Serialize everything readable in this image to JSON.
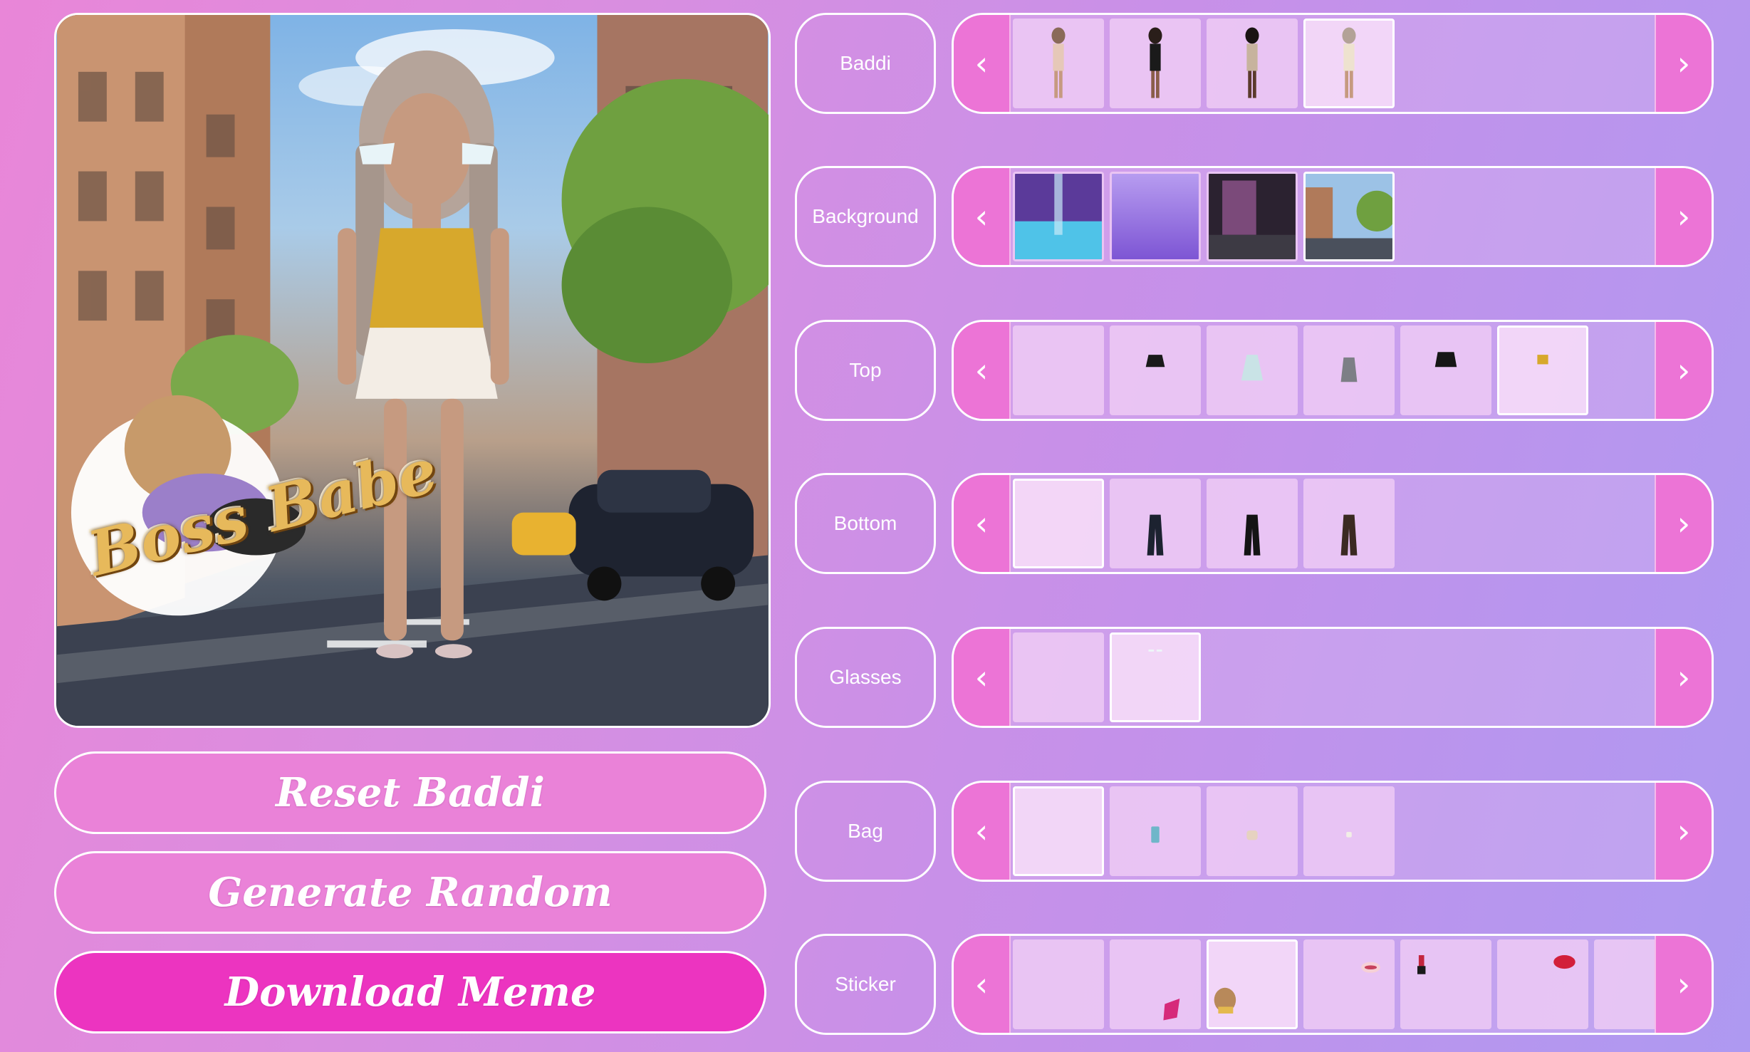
{
  "preview": {
    "sticker_text": "Boss Babe"
  },
  "actions": {
    "reset_label": "Reset Baddi",
    "random_label": "Generate Random",
    "download_label": "Download Meme"
  },
  "arrows": {
    "prev": "‹",
    "next": "›"
  },
  "categories": [
    {
      "label": "Baddi",
      "thumbs": [
        "doll-1",
        "doll-2",
        "doll-3",
        "doll-4"
      ],
      "selected": 3
    },
    {
      "label": "Background",
      "thumbs": [
        "pool-scene",
        "purple-gradient",
        "dark-room",
        "city-street"
      ],
      "selected": 3
    },
    {
      "label": "Top",
      "thumbs": [
        "none",
        "black-jacket",
        "light-dress",
        "patterned-top",
        "black-crop",
        "gold-top"
      ],
      "selected": 5
    },
    {
      "label": "Bottom",
      "thumbs": [
        "none",
        "flare-pants-dark",
        "flare-pants-black",
        "flare-pants-brown"
      ],
      "selected": 0
    },
    {
      "label": "Glasses",
      "thumbs": [
        "none",
        "white-glasses"
      ],
      "selected": 1
    },
    {
      "label": "Bag",
      "thumbs": [
        "none",
        "blue-bag",
        "beige-bag",
        "small-bag"
      ],
      "selected": 0
    },
    {
      "label": "Sticker",
      "thumbs": [
        "none",
        "fire-sticker",
        "boss-babe-sticker",
        "lips-sticker",
        "lipstick-sticker",
        "red-lips-sticker",
        "more"
      ],
      "selected": 2
    }
  ],
  "colors": {
    "arrow_bg": "#ec74d6",
    "download_bg": "#ec34c0",
    "button_bg": "#ea82d8",
    "border": "#ffffff"
  }
}
